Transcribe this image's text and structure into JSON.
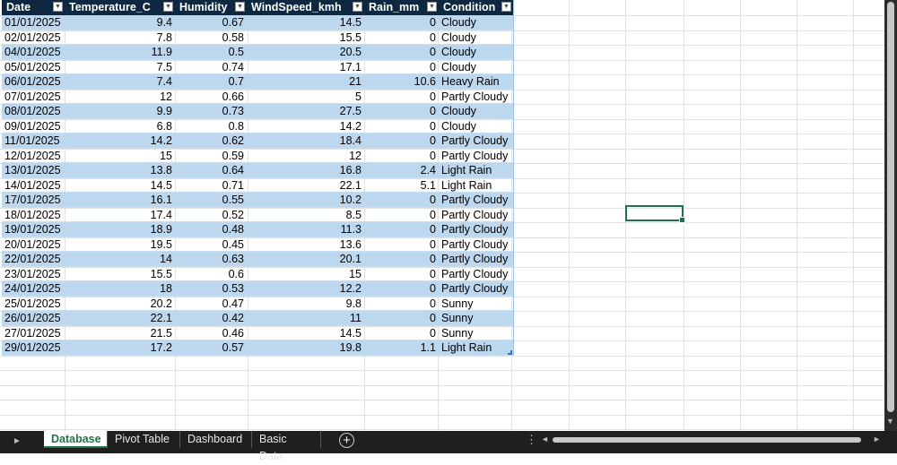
{
  "table": {
    "headers": [
      "Date",
      "Temperature_C",
      "Humidity",
      "WindSpeed_kmh",
      "Rain_mm",
      "Condition"
    ],
    "rows": [
      [
        "01/01/2025",
        "9.4",
        "0.67",
        "14.5",
        "0",
        "Cloudy"
      ],
      [
        "02/01/2025",
        "7.8",
        "0.58",
        "15.5",
        "0",
        "Cloudy"
      ],
      [
        "04/01/2025",
        "11.9",
        "0.5",
        "20.5",
        "0",
        "Cloudy"
      ],
      [
        "05/01/2025",
        "7.5",
        "0.74",
        "17.1",
        "0",
        "Cloudy"
      ],
      [
        "06/01/2025",
        "7.4",
        "0.7",
        "21",
        "10.6",
        "Heavy Rain"
      ],
      [
        "07/01/2025",
        "12",
        "0.66",
        "5",
        "0",
        "Partly Cloudy"
      ],
      [
        "08/01/2025",
        "9.9",
        "0.73",
        "27.5",
        "0",
        "Cloudy"
      ],
      [
        "09/01/2025",
        "6.8",
        "0.8",
        "14.2",
        "0",
        "Cloudy"
      ],
      [
        "11/01/2025",
        "14.2",
        "0.62",
        "18.4",
        "0",
        "Partly Cloudy"
      ],
      [
        "12/01/2025",
        "15",
        "0.59",
        "12",
        "0",
        "Partly Cloudy"
      ],
      [
        "13/01/2025",
        "13.8",
        "0.64",
        "16.8",
        "2.4",
        "Light Rain"
      ],
      [
        "14/01/2025",
        "14.5",
        "0.71",
        "22.1",
        "5.1",
        "Light Rain"
      ],
      [
        "17/01/2025",
        "16.1",
        "0.55",
        "10.2",
        "0",
        "Partly Cloudy"
      ],
      [
        "18/01/2025",
        "17.4",
        "0.52",
        "8.5",
        "0",
        "Partly Cloudy"
      ],
      [
        "19/01/2025",
        "18.9",
        "0.48",
        "11.3",
        "0",
        "Partly Cloudy"
      ],
      [
        "20/01/2025",
        "19.5",
        "0.45",
        "13.6",
        "0",
        "Partly Cloudy"
      ],
      [
        "22/01/2025",
        "14",
        "0.63",
        "20.1",
        "0",
        "Partly Cloudy"
      ],
      [
        "23/01/2025",
        "15.5",
        "0.6",
        "15",
        "0",
        "Partly Cloudy"
      ],
      [
        "24/01/2025",
        "18",
        "0.53",
        "12.2",
        "0",
        "Partly Cloudy"
      ],
      [
        "25/01/2025",
        "20.2",
        "0.47",
        "9.8",
        "0",
        "Sunny"
      ],
      [
        "26/01/2025",
        "22.1",
        "0.42",
        "11",
        "0",
        "Sunny"
      ],
      [
        "27/01/2025",
        "21.5",
        "0.46",
        "14.5",
        "0",
        "Sunny"
      ],
      [
        "29/01/2025",
        "17.2",
        "0.57",
        "19.8",
        "1.1",
        "Light Rain"
      ]
    ]
  },
  "sheet_tabs": [
    {
      "label": "Database",
      "active": true
    },
    {
      "label": "Pivot Table",
      "active": false
    },
    {
      "label": "Dashboard",
      "active": false
    },
    {
      "label": "Basic Data",
      "active": false
    }
  ],
  "icons": {
    "filter": "dropdown-filter-icon",
    "add_sheet": "plus-circle-icon",
    "tab_nav": "triangle-right-icon",
    "more": "vertical-dots-icon"
  },
  "colors": {
    "header_bg": "#0e2841",
    "band_bg": "#bdd7ee",
    "accent": "#217346"
  }
}
